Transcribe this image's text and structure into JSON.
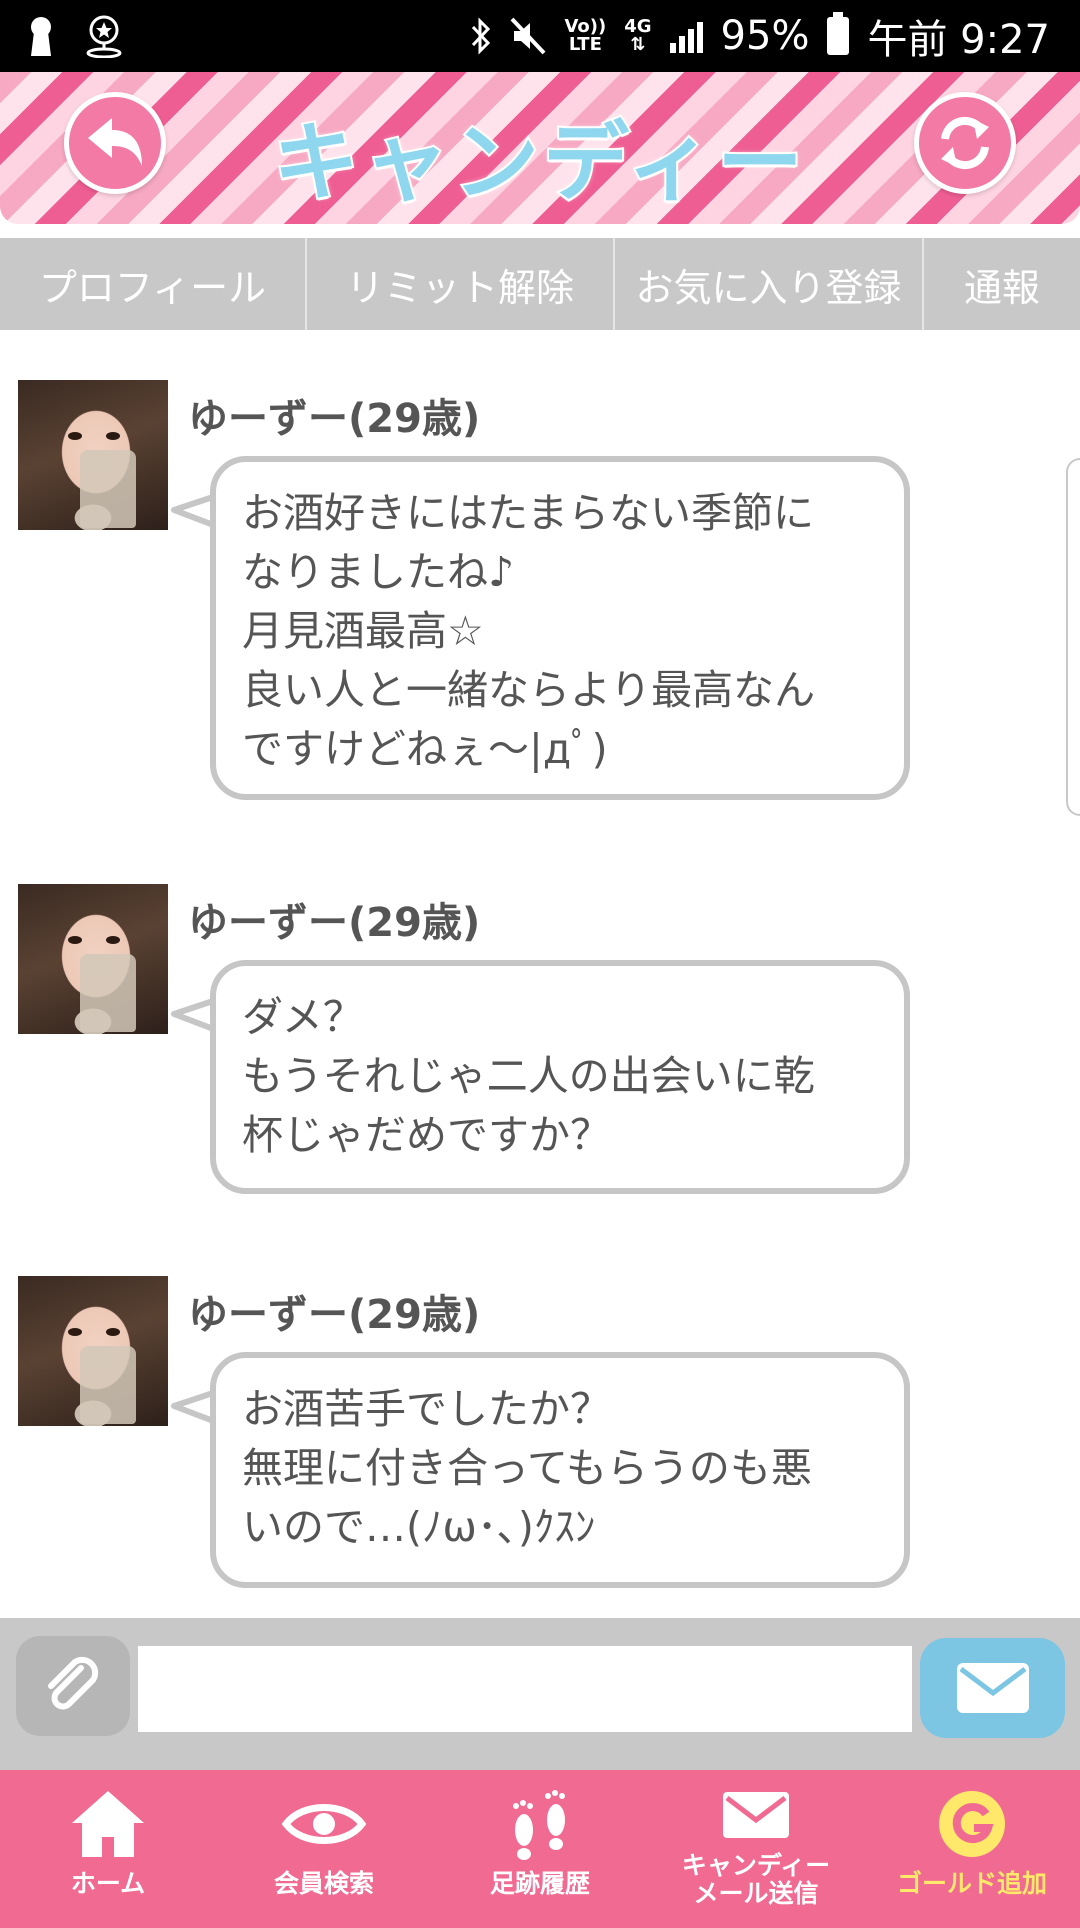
{
  "status_bar": {
    "volte_top": "Vo))",
    "volte_bottom": "LTE",
    "network_top": "4G",
    "network_bottom": "⇅",
    "battery_percent": "95%",
    "time": "午前 9:27"
  },
  "header": {
    "logo_text": "キャンディー",
    "back_icon": "back-arrow-icon",
    "refresh_icon": "refresh-icon"
  },
  "tabs": [
    {
      "label": "プロフィール"
    },
    {
      "label": "リミット解除"
    },
    {
      "label": "お気に入り登録"
    },
    {
      "label": "通報"
    }
  ],
  "messages": [
    {
      "sender": "ゆーずー(29歳)",
      "text": "お酒好きにはたまらない季節に\nなりましたね♪\n月見酒最高☆\n良い人と一緒ならより最高なん\nですけどねぇ～|дﾟ)"
    },
    {
      "sender": "ゆーずー(29歳)",
      "text": "ダメ？\nもうそれじゃ二人の出会いに乾\n杯じゃだめですか？"
    },
    {
      "sender": "ゆーずー(29歳)",
      "text": "お酒苦手でしたか？\n無理に付き合ってもらうのも悪\nいので…(ﾉω･､)ｸｽﾝ"
    }
  ],
  "compose": {
    "input_value": "",
    "input_placeholder": "",
    "attach_icon": "paperclip-icon",
    "send_icon": "envelope-icon"
  },
  "bottom_nav": [
    {
      "label": "ホーム",
      "icon": "home-icon"
    },
    {
      "label": "会員検索",
      "icon": "eye-icon"
    },
    {
      "label": "足跡履歴",
      "icon": "footprints-icon"
    },
    {
      "label": "キャンディー\nメール送信",
      "icon": "mail-icon"
    },
    {
      "label": "ゴールド追加",
      "icon": "gold-coin-icon"
    }
  ],
  "colors": {
    "header_pink": "#ef5e92",
    "nav_pink": "#f06a92",
    "tab_gray": "#c8c8c8",
    "send_blue": "#7cc6e4",
    "gold_label": "#ffe86a",
    "bubble_border": "#c6c6c6"
  }
}
